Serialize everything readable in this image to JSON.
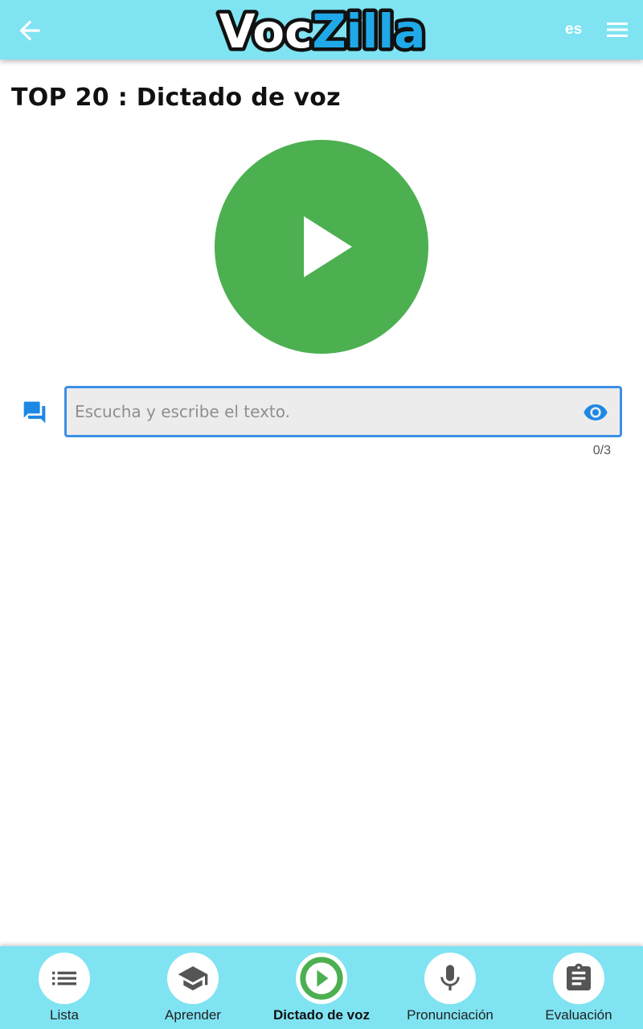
{
  "header": {
    "app_name": "VocZilla",
    "logo_part1": "Voc",
    "logo_part2": "Zilla",
    "language": "es",
    "back_icon": "arrow-left-icon",
    "menu_icon": "hamburger-menu-icon"
  },
  "main": {
    "title": "TOP 20 : Dictado de voz",
    "play_icon": "play-icon",
    "input": {
      "placeholder": "Escucha y escribe el texto.",
      "value": ""
    },
    "counter": "0/3"
  },
  "bottom_nav": {
    "items": [
      {
        "label": "Lista",
        "icon": "list-icon"
      },
      {
        "label": "Aprender",
        "icon": "graduation-cap-icon"
      },
      {
        "label": "Dictado de voz",
        "icon": "play-circle-icon",
        "active": true
      },
      {
        "label": "Pronunciación",
        "icon": "microphone-icon"
      },
      {
        "label": "Evaluación",
        "icon": "clipboard-icon"
      }
    ]
  },
  "colors": {
    "header_bg": "#7fe3f2",
    "play_green": "#4caf50",
    "accent_blue": "#3d8fe6",
    "logo_blue": "#1fa9e8"
  }
}
